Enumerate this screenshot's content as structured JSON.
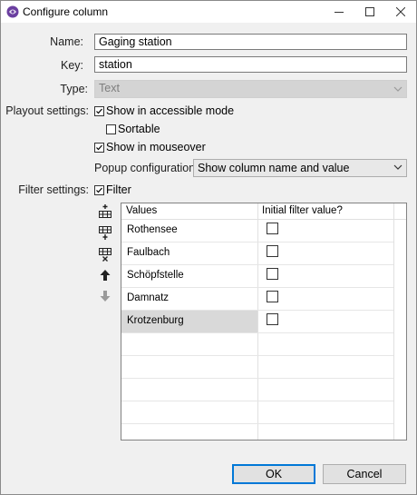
{
  "window": {
    "title": "Configure column"
  },
  "form": {
    "name_label": "Name:",
    "name_value": "Gaging station",
    "key_label": "Key:",
    "key_value": "station",
    "type_label": "Type:",
    "type_value": "Text"
  },
  "playout": {
    "label": "Playout settings:",
    "accessible": {
      "label": "Show in accessible mode",
      "checked": true
    },
    "sortable": {
      "label": "Sortable",
      "checked": false
    },
    "mouseover": {
      "label": "Show in mouseover",
      "checked": true
    },
    "popup_label": "Popup configuration:",
    "popup_value": "Show column name and value"
  },
  "filter": {
    "label": "Filter settings:",
    "filter_checkbox": {
      "label": "Filter",
      "checked": true
    },
    "tools": [
      "add-row-above-icon",
      "add-row-below-icon",
      "delete-row-icon",
      "move-up-icon",
      "move-down-icon"
    ],
    "table": {
      "headers": [
        "Values",
        "Initial filter value?"
      ],
      "rows": [
        {
          "value": "Rothensee",
          "checked": false
        },
        {
          "value": "Faulbach",
          "checked": false
        },
        {
          "value": "Schöpfstelle",
          "checked": false
        },
        {
          "value": "Damnatz",
          "checked": false
        },
        {
          "value": "Krotzenburg",
          "checked": false,
          "selected": true
        }
      ]
    }
  },
  "buttons": {
    "ok": "OK",
    "cancel": "Cancel"
  },
  "colors": {
    "accent": "#0078d7",
    "selection": "#d9d9d9",
    "disabled_field": "#d4d4d4"
  }
}
